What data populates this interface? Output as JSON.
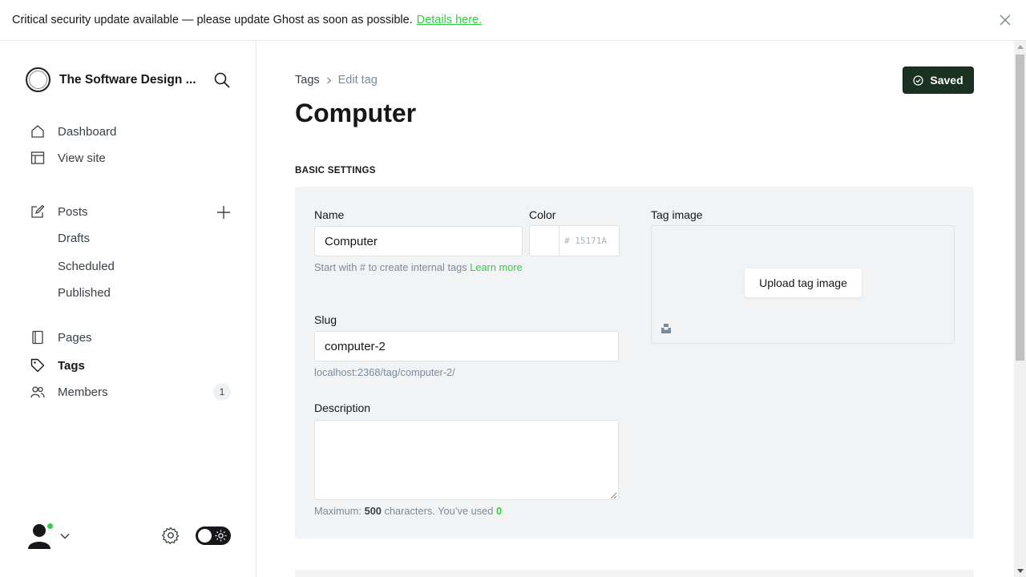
{
  "banner": {
    "message": "Critical security update available — please update Ghost as soon as possible.",
    "link_label": "Details here."
  },
  "sidebar": {
    "site_title": "The Software Design ...",
    "nav": [
      {
        "label": "Dashboard",
        "icon": "home-icon"
      },
      {
        "label": "View site",
        "icon": "layout-icon"
      },
      {
        "label": "Posts",
        "icon": "edit-icon"
      },
      {
        "label": "Drafts"
      },
      {
        "label": "Scheduled"
      },
      {
        "label": "Published"
      },
      {
        "label": "Pages",
        "icon": "page-icon"
      },
      {
        "label": "Tags",
        "icon": "tag-icon",
        "active": true
      },
      {
        "label": "Members",
        "icon": "members-icon"
      }
    ],
    "members_count": "1"
  },
  "header": {
    "breadcrumb_parent": "Tags",
    "breadcrumb_current": "Edit tag",
    "title": "Computer",
    "saved_label": "Saved"
  },
  "form": {
    "section_title": "BASIC SETTINGS",
    "name_label": "Name",
    "name_value": "Computer",
    "name_hint": "Start with # to create internal tags",
    "name_hint_link": "Learn more",
    "color_label": "Color",
    "color_hex_placeholder": "# 15171A",
    "image_label": "Tag image",
    "upload_label": "Upload tag image",
    "slug_label": "Slug",
    "slug_value": "computer-2",
    "slug_url": "localhost:2368/tag/computer-2/",
    "description_label": "Description",
    "description_value": "",
    "desc_hint_prefix": "Maximum:",
    "desc_max": "500",
    "desc_hint_middle": "characters. You’ve used",
    "desc_used": "0"
  },
  "colors": {
    "accent_green": "#30cf43",
    "saved_button_bg": "#1b3223",
    "panel_bg": "#f1f3f4"
  }
}
